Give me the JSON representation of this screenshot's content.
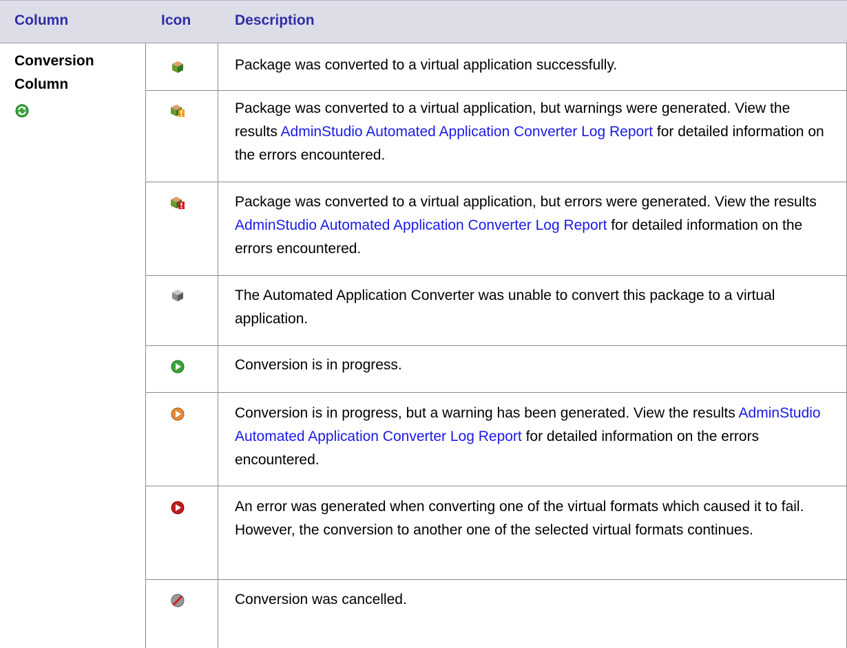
{
  "header": {
    "column": "Column",
    "icon": "Icon",
    "description": "Description"
  },
  "section": {
    "title_line1": "Conversion",
    "title_line2": "Column",
    "icon": "refresh-icon"
  },
  "rows": [
    {
      "icon": "package-success-icon",
      "text": "Package was converted to a virtual application successfully."
    },
    {
      "icon": "package-warning-icon",
      "pre": "Package was converted to a virtual application, but warnings were generated. View the results ",
      "link": "AdminStudio Automated Application Converter Log Report",
      "post": " for detailed information on the errors encountered."
    },
    {
      "icon": "package-error-icon",
      "pre": "Package was converted to a virtual application, but errors were generated. View the results ",
      "link": "AdminStudio Automated Application Converter Log Report",
      "post": " for detailed information on the errors encountered."
    },
    {
      "icon": "package-unable-icon",
      "text": "The Automated Application Converter was unable to convert this package to a virtual application."
    },
    {
      "icon": "play-green-icon",
      "text": "Conversion is in progress."
    },
    {
      "icon": "play-orange-icon",
      "pre": "Conversion is in progress, but a warning has been generated. View the results ",
      "link": "AdminStudio Automated Application Converter Log Report",
      "post": " for detailed information on the errors encountered."
    },
    {
      "icon": "play-red-icon",
      "text": "An error was generated when converting one of the virtual formats which caused it to fail. However, the conversion to another one of the selected virtual formats continues."
    },
    {
      "icon": "cancelled-icon",
      "text": "Conversion was cancelled."
    }
  ],
  "colors": {
    "header_bg": "#dddde8",
    "header_text": "#2e2ea6",
    "link": "#1a1ae6"
  }
}
